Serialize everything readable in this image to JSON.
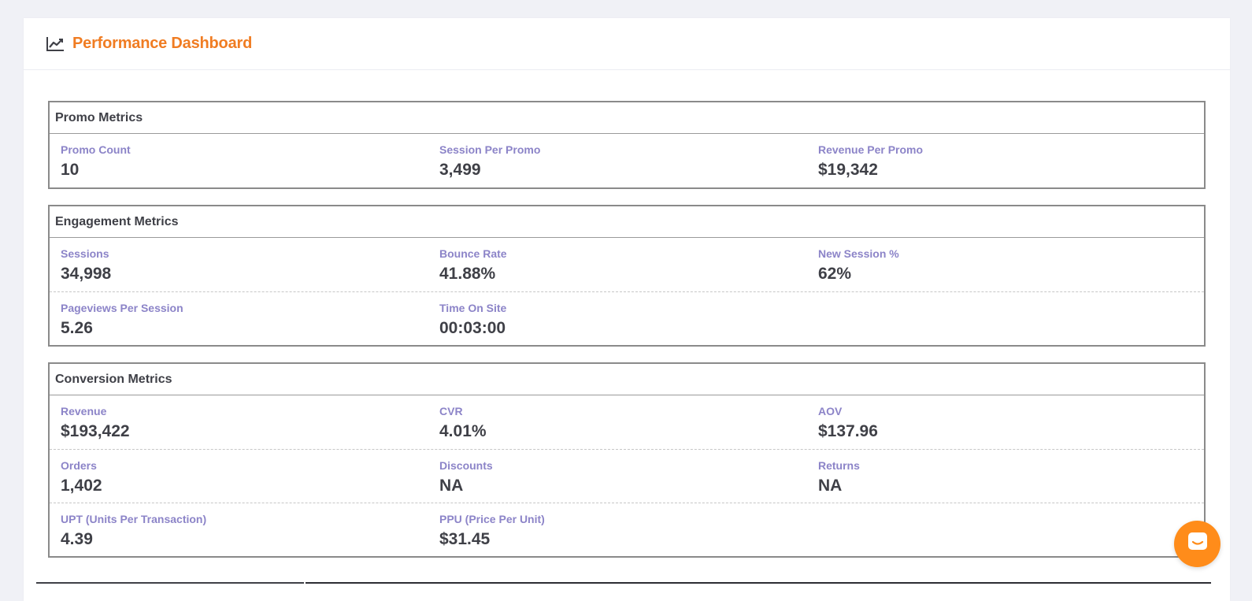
{
  "header": {
    "title": "Performance Dashboard",
    "icon": "line-chart-icon",
    "title_color": "#f07c22"
  },
  "panels": [
    {
      "title": "Promo Metrics",
      "rows": [
        [
          {
            "label": "Promo Count",
            "value": "10"
          },
          {
            "label": "Session Per Promo",
            "value": "3,499"
          },
          {
            "label": "Revenue Per Promo",
            "value": "$19,342"
          }
        ]
      ]
    },
    {
      "title": "Engagement Metrics",
      "rows": [
        [
          {
            "label": "Sessions",
            "value": "34,998"
          },
          {
            "label": "Bounce Rate",
            "value": "41.88%"
          },
          {
            "label": "New Session %",
            "value": "62%"
          }
        ],
        [
          {
            "label": "Pageviews Per Session",
            "value": "5.26"
          },
          {
            "label": "Time On Site",
            "value": "00:03:00"
          }
        ]
      ]
    },
    {
      "title": "Conversion Metrics",
      "rows": [
        [
          {
            "label": "Revenue",
            "value": "$193,422"
          },
          {
            "label": "CVR",
            "value": "4.01%"
          },
          {
            "label": "AOV",
            "value": "$137.96"
          }
        ],
        [
          {
            "label": "Orders",
            "value": "1,402"
          },
          {
            "label": "Discounts",
            "value": "NA"
          },
          {
            "label": "Returns",
            "value": "NA"
          }
        ],
        [
          {
            "label": "UPT (Units Per Transaction)",
            "value": "4.39"
          },
          {
            "label": "PPU (Price Per Unit)",
            "value": "$31.45"
          }
        ]
      ]
    }
  ],
  "chat": {
    "icon": "chat-icon",
    "color": "#ff8c1a"
  },
  "colors": {
    "label": "#8c84c8",
    "value": "#3f4047",
    "accent": "#f07c22"
  }
}
